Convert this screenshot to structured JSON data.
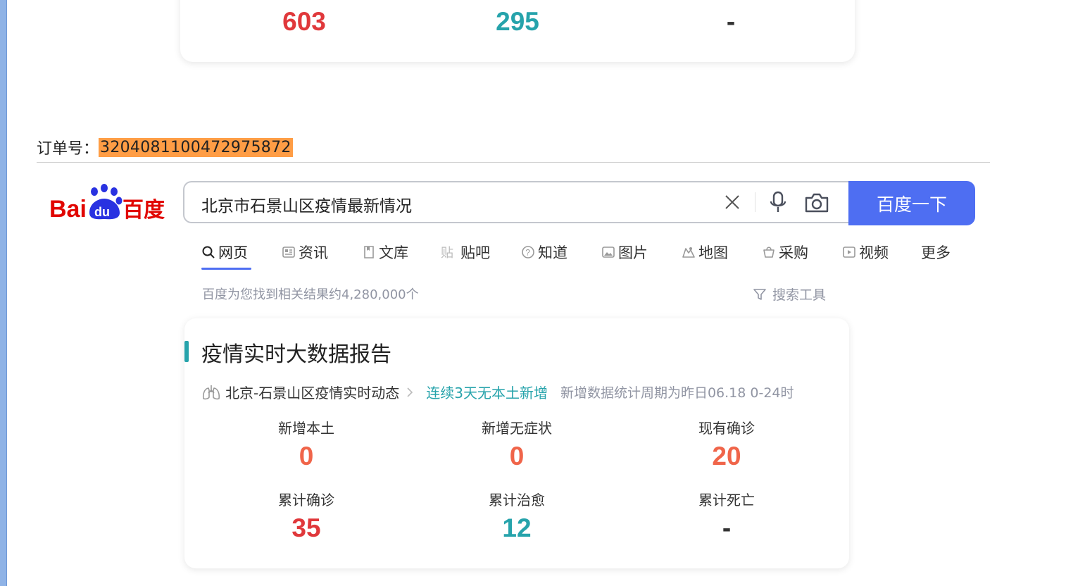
{
  "top_card": {
    "values": [
      "603",
      "295",
      "-"
    ]
  },
  "order": {
    "label": "订单号：",
    "number": "3204081100472975872"
  },
  "baidu": {
    "logo_text_left": "Bai",
    "logo_text_du": "du",
    "logo_text_cn": "百度",
    "query": "北京市石景山区疫情最新情况",
    "search_button": "百度一下"
  },
  "tabs": [
    {
      "label": "网页",
      "icon": "search-icon"
    },
    {
      "label": "资讯",
      "icon": "news-icon"
    },
    {
      "label": "文库",
      "icon": "doc-icon"
    },
    {
      "label": "贴吧",
      "icon": "tieba-icon"
    },
    {
      "label": "知道",
      "icon": "question-icon"
    },
    {
      "label": "图片",
      "icon": "image-icon"
    },
    {
      "label": "地图",
      "icon": "map-icon"
    },
    {
      "label": "采购",
      "icon": "basket-icon"
    },
    {
      "label": "视频",
      "icon": "video-icon"
    },
    {
      "label": "更多",
      "icon": ""
    }
  ],
  "results": {
    "count_text": "百度为您找到相关结果约4,280,000个",
    "tools": "搜索工具"
  },
  "card": {
    "title": "疫情实时大数据报告",
    "location_link": "北京-石景山区疫情实时动态",
    "tag": "连续3天无本土新增",
    "note": "新增数据统计周期为昨日06.18 0-24时",
    "stats": [
      {
        "label": "新增本土",
        "value": "0"
      },
      {
        "label": "新增无症状",
        "value": "0"
      },
      {
        "label": "现有确诊",
        "value": "20"
      },
      {
        "label": "累计确诊",
        "value": "35"
      },
      {
        "label": "累计治愈",
        "value": "12"
      },
      {
        "label": "累计死亡",
        "value": "-"
      }
    ]
  },
  "colors": {
    "brand_blue": "#4e6ef2",
    "teal": "#26a3ab",
    "red": "#e0383b",
    "orange": "#f0654a",
    "highlight": "#ff9d45"
  }
}
